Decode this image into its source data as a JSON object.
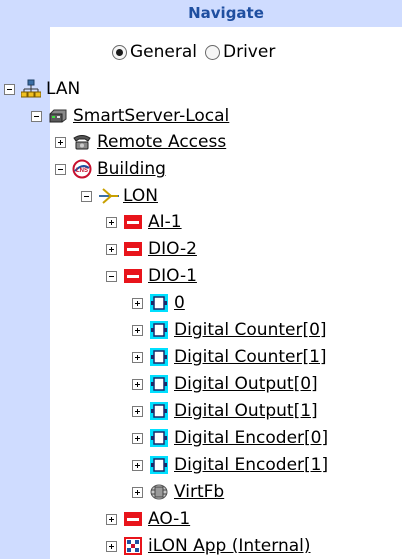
{
  "header": {
    "title": "Navigate"
  },
  "view_mode": {
    "options": [
      {
        "label": "General",
        "selected": true
      },
      {
        "label": "Driver",
        "selected": false
      }
    ]
  },
  "tree": {
    "lan": "LAN",
    "smartserver": "SmartServer-Local",
    "remote_access": "Remote Access",
    "building": "Building",
    "lon": "LON",
    "ai1": "AI-1",
    "dio2": "DIO-2",
    "dio1": "DIO-1",
    "dio1_children": [
      "0",
      "Digital Counter[0]",
      "Digital Counter[1]",
      "Digital Output[0]",
      "Digital Output[1]",
      "Digital Encoder[0]",
      "Digital Encoder[1]"
    ],
    "virtfb": "VirtFb",
    "ao1": "AO-1",
    "ilon_app": "iLON App (Internal)"
  },
  "colors": {
    "panel": "#cfdcff",
    "header_text": "#1f4fa0",
    "device_red": "#e8141b",
    "fb_cyan": "#00e0ff"
  }
}
